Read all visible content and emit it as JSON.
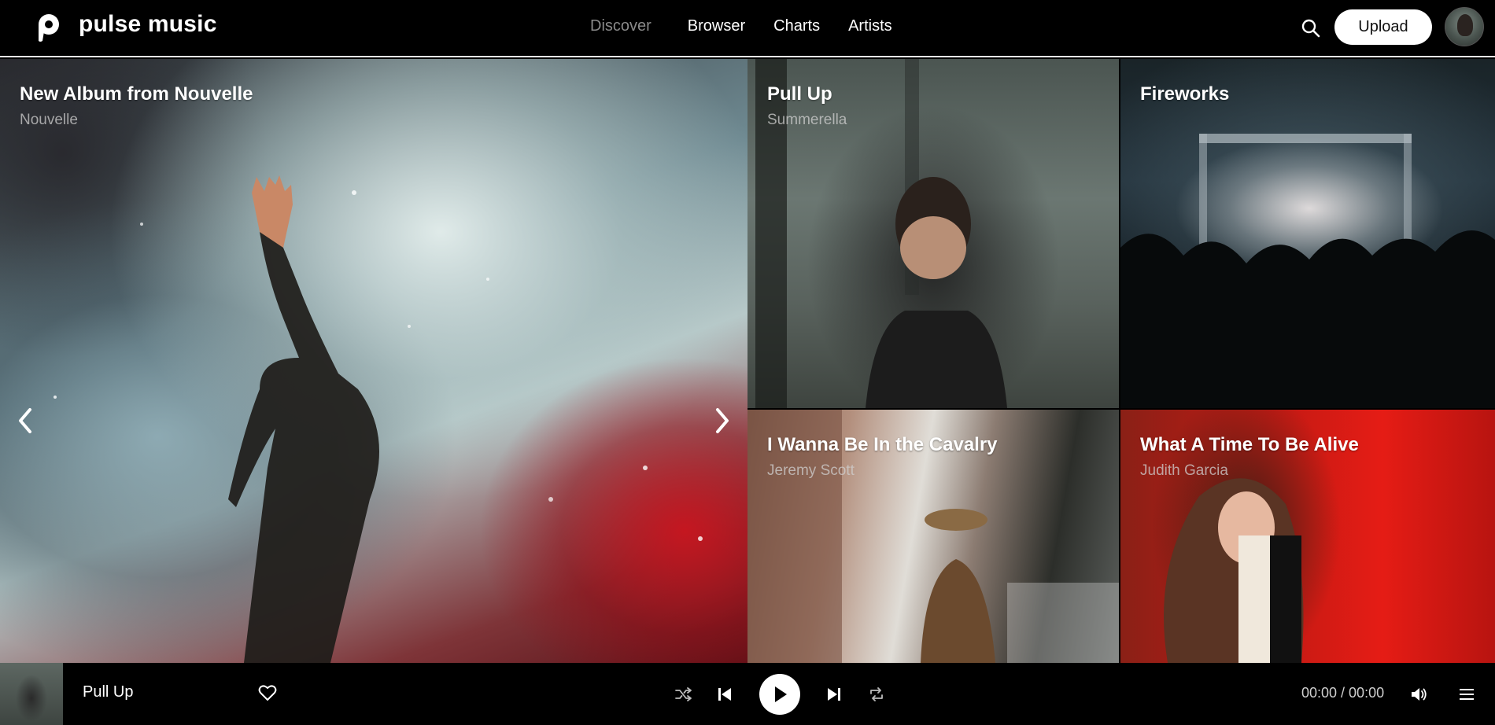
{
  "header": {
    "brand": "pulse music",
    "nav": [
      {
        "label": "Discover",
        "active": true
      },
      {
        "label": "Browser",
        "active": false
      },
      {
        "label": "Charts",
        "active": false
      },
      {
        "label": "Artists",
        "active": false
      }
    ],
    "upload_label": "Upload"
  },
  "featured": {
    "title": "New Album from Nouvelle",
    "subtitle": "Nouvelle"
  },
  "tiles": [
    {
      "title": "Pull Up",
      "subtitle": "Summerella"
    },
    {
      "title": "Fireworks",
      "subtitle": ""
    },
    {
      "title": "I Wanna Be In the Cavalry",
      "subtitle": "Jeremy Scott"
    },
    {
      "title": "What A Time To Be Alive",
      "subtitle": "Judith Garcia"
    }
  ],
  "player": {
    "track_title": "Pull Up",
    "time": "00:00 / 00:00"
  },
  "colors": {
    "background": "#000000",
    "accent": "#ffffff",
    "muted_nav": "#8a8a8a"
  },
  "icons": {
    "logo": "pulse-logo-icon",
    "search": "search-icon",
    "prev_slide": "chevron-left-icon",
    "next_slide": "chevron-right-icon",
    "like": "heart-icon",
    "shuffle": "shuffle-icon",
    "previous": "skip-previous-icon",
    "play": "play-icon",
    "next": "skip-next-icon",
    "repeat": "repeat-icon",
    "volume": "volume-icon",
    "queue": "menu-icon"
  }
}
